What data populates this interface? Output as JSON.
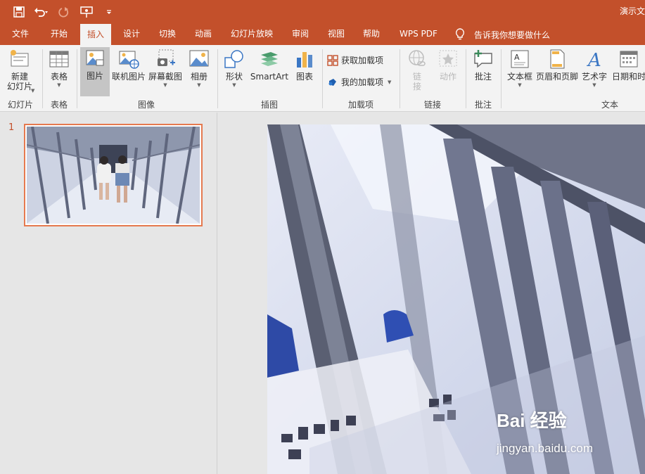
{
  "window": {
    "title": "演示文"
  },
  "qat": {
    "icons": [
      "save-icon",
      "undo-icon",
      "redo-icon",
      "present-icon",
      "customize-icon"
    ]
  },
  "tabs": [
    "文件",
    "开始",
    "插入",
    "设计",
    "切换",
    "动画",
    "幻灯片放映",
    "审阅",
    "视图",
    "帮助",
    "WPS PDF"
  ],
  "active_tab": "插入",
  "tellme": "告诉我你想要做什么",
  "ribbon": {
    "new_slide": {
      "line1": "新建",
      "line2": "幻灯片"
    },
    "table": "表格",
    "picture": "图片",
    "online_picture": "联机图片",
    "screenshot": "屏幕截图",
    "album": "相册",
    "shapes": "形状",
    "smartart": "SmartArt",
    "chart": "图表",
    "get_addins": "获取加载项",
    "my_addins": "我的加载项",
    "link": {
      "line1": "链",
      "line2": "接"
    },
    "action": "动作",
    "comment": "批注",
    "textbox": "文本框",
    "header_footer": "页眉和页脚",
    "wordart": "艺术字",
    "datetime": "日期和时",
    "groups": {
      "slides": "幻灯片",
      "tables": "表格",
      "images": "图像",
      "illustrations": "插图",
      "addins": "加载项",
      "links": "链接",
      "comments": "批注",
      "text": "文本"
    }
  },
  "slides": {
    "number": "1"
  },
  "watermark": {
    "logo": "Bai 经验",
    "url": "jingyan.baidu.com"
  },
  "colors": {
    "accent": "#c3502b",
    "ribbon_bg": "#f3f3f3",
    "pane_bg": "#e6e6e6",
    "thumb_border": "#e5794f"
  }
}
